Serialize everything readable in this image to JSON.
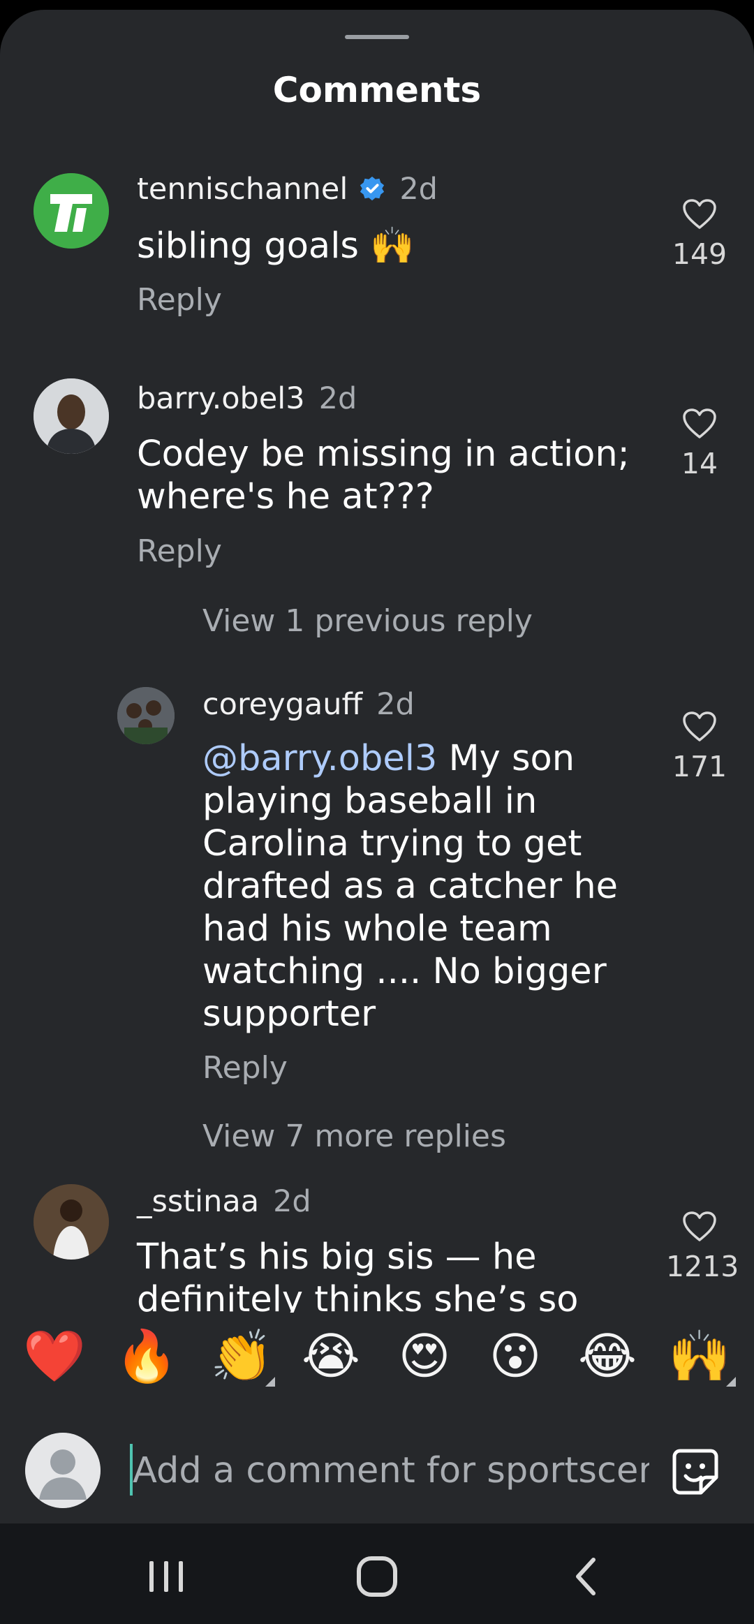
{
  "sheet": {
    "title": "Comments"
  },
  "comments": [
    {
      "username": "tennischannel",
      "verified": true,
      "time": "2d",
      "text": "sibling goals 🙌",
      "reply_label": "Reply",
      "likes": "149"
    },
    {
      "username": "barry.obel3",
      "verified": false,
      "time": "2d",
      "text_lines": [
        "Codey be missing in action;",
        "where's he at???"
      ],
      "reply_label": "Reply",
      "likes": "14",
      "view_previous_label": "View 1 previous reply"
    },
    {
      "username": "coreygauff",
      "verified": false,
      "time": "2d",
      "mention": "@barry.obel3",
      "text_lines": [
        " My son",
        "playing baseball in",
        "Carolina trying to get",
        "drafted as a catcher he",
        "had his whole team",
        "watching .... No bigger",
        "supporter"
      ],
      "reply_label": "Reply",
      "likes": "171",
      "view_more_label": "View 7 more replies"
    },
    {
      "username": "_sstinaa",
      "verified": false,
      "time": "2d",
      "text_lines": [
        "That’s his big sis — he",
        "definitely thinks she’s so"
      ],
      "likes": "1213"
    }
  ],
  "emoji_bar": [
    "❤️",
    "🔥",
    "👏",
    "😭",
    "😍",
    "😮",
    "😂",
    "🙌"
  ],
  "input": {
    "placeholder": "Add a comment for sportscent"
  },
  "colors": {
    "sheet_bg": "#26282b",
    "mention": "#aecbfa",
    "verified": "#3897f0",
    "caret": "#4fc3b0",
    "tennischannel_brand": "#3fae48"
  },
  "icons": {
    "like": "heart-outline-icon",
    "verified": "verified-badge-icon",
    "sticker": "sticker-icon",
    "nav": [
      "recent-apps-icon",
      "home-icon",
      "back-icon"
    ]
  }
}
